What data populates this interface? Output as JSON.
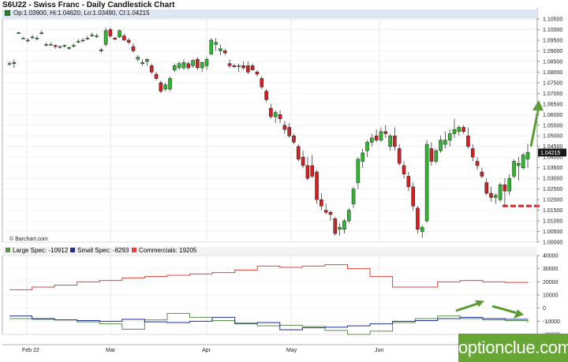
{
  "header": {
    "title": "S6U22 - Swiss Franc - Daily Candlestick Chart",
    "ohlc": "Op:1.03900, Hi:1.04620, Lo:1.03490, Cl:1.04215"
  },
  "credit": "© Barchart.com",
  "logo_text": "optionclue.com",
  "colors": {
    "up": "#2fb82f",
    "down": "#d42020",
    "large_spec": "#5a8f4a",
    "small_spec": "#1f2f8f",
    "commercials": "#e0443a",
    "support": "#e02020",
    "arrow": "#5a9e32"
  },
  "chart_data": [
    {
      "type": "candlestick",
      "title": "S6U22 - Swiss Franc - Daily Candlestick Chart",
      "y_ticks": [
        "1.10500",
        "1.10000",
        "1.09500",
        "1.09000",
        "1.08500",
        "1.08000",
        "1.07500",
        "1.07000",
        "1.06500",
        "1.06000",
        "1.05500",
        "1.05000",
        "1.04500",
        "1.04000",
        "1.03500",
        "1.03000",
        "1.02500",
        "1.02000",
        "1.01500",
        "1.01000",
        "1.00500",
        "1.00000"
      ],
      "ylim": [
        1.0,
        1.105
      ],
      "x_ticks": [
        "Feb 22",
        "Mar",
        "Apr",
        "May",
        "Jun"
      ],
      "last_price": "1.04215",
      "ohlc": [
        [
          1.084,
          1.085,
          1.083,
          1.084
        ],
        [
          1.084,
          1.086,
          1.082,
          1.0845
        ],
        [
          1.0985,
          1.099,
          1.098,
          1.0985
        ],
        [
          1.096,
          1.0965,
          1.0955,
          1.096
        ],
        [
          1.095,
          1.096,
          1.094,
          1.095
        ],
        [
          1.0965,
          1.0975,
          1.0955,
          1.0965
        ],
        [
          1.096,
          1.097,
          1.095,
          1.096
        ],
        [
          1.0985,
          1.0995,
          1.0975,
          1.0985
        ],
        [
          1.093,
          1.094,
          1.092,
          1.093
        ],
        [
          1.093,
          1.094,
          1.0925,
          1.093
        ],
        [
          1.0925,
          1.093,
          1.091,
          1.092
        ],
        [
          1.092,
          1.0925,
          1.091,
          1.092
        ],
        [
          1.0925,
          1.093,
          1.0915,
          1.0925
        ],
        [
          1.0915,
          1.092,
          1.0905,
          1.0915
        ],
        [
          1.0925,
          1.0935,
          1.0915,
          1.0925
        ],
        [
          1.0945,
          1.0955,
          1.0935,
          1.0945
        ],
        [
          1.095,
          1.096,
          1.094,
          1.095
        ],
        [
          1.096,
          1.097,
          1.095,
          1.096
        ],
        [
          1.0975,
          1.0985,
          1.0965,
          1.0975
        ],
        [
          1.097,
          1.098,
          1.096,
          1.097
        ],
        [
          1.0905,
          1.0915,
          1.089,
          1.09
        ],
        [
          1.093,
          1.101,
          1.092,
          1.0995
        ],
        [
          1.1,
          1.101,
          1.096,
          1.097
        ],
        [
          1.096,
          1.0965,
          1.095,
          1.0955
        ],
        [
          1.0965,
          1.1,
          1.096,
          1.0995
        ],
        [
          1.097,
          1.098,
          1.095,
          1.095
        ],
        [
          1.095,
          1.096,
          1.093,
          1.094
        ],
        [
          1.092,
          1.0935,
          1.089,
          1.09
        ],
        [
          1.086,
          1.088,
          1.085,
          1.087
        ],
        [
          1.084,
          1.086,
          1.083,
          1.0845
        ],
        [
          1.085,
          1.0865,
          1.083,
          1.086
        ],
        [
          1.083,
          1.084,
          1.079,
          1.08
        ],
        [
          1.079,
          1.08,
          1.076,
          1.077
        ],
        [
          1.075,
          1.076,
          1.07,
          1.071
        ],
        [
          1.072,
          1.075,
          1.071,
          1.074
        ],
        [
          1.072,
          1.078,
          1.071,
          1.077
        ],
        [
          1.081,
          1.084,
          1.08,
          1.083
        ],
        [
          1.082,
          1.085,
          1.081,
          1.084
        ],
        [
          1.082,
          1.086,
          1.081,
          1.0845
        ],
        [
          1.084,
          1.085,
          1.081,
          1.082
        ],
        [
          1.083,
          1.086,
          1.082,
          1.0855
        ],
        [
          1.086,
          1.087,
          1.081,
          1.082
        ],
        [
          1.082,
          1.085,
          1.08,
          1.0845
        ],
        [
          1.083,
          1.087,
          1.081,
          1.086
        ],
        [
          1.0885,
          1.096,
          1.088,
          1.095
        ],
        [
          1.093,
          1.096,
          1.09,
          1.094
        ],
        [
          1.09,
          1.093,
          1.088,
          1.091
        ],
        [
          1.09,
          1.091,
          1.088,
          1.089
        ],
        [
          1.084,
          1.086,
          1.082,
          1.083
        ],
        [
          1.083,
          1.084,
          1.082,
          1.0825
        ],
        [
          1.083,
          1.084,
          1.08,
          1.083
        ],
        [
          1.083,
          1.085,
          1.081,
          1.082
        ],
        [
          1.083,
          1.085,
          1.079,
          1.08
        ],
        [
          1.083,
          1.084,
          1.081,
          1.081
        ],
        [
          1.08,
          1.081,
          1.078,
          1.079
        ],
        [
          1.077,
          1.078,
          1.072,
          1.073
        ],
        [
          1.071,
          1.072,
          1.066,
          1.067
        ],
        [
          1.063,
          1.065,
          1.058,
          1.059
        ],
        [
          1.059,
          1.062,
          1.056,
          1.061
        ],
        [
          1.06,
          1.062,
          1.056,
          1.058
        ],
        [
          1.055,
          1.057,
          1.051,
          1.053
        ],
        [
          1.054,
          1.056,
          1.049,
          1.05
        ],
        [
          1.05,
          1.051,
          1.046,
          1.047
        ],
        [
          1.045,
          1.046,
          1.038,
          1.039
        ],
        [
          1.04,
          1.043,
          1.035,
          1.036
        ],
        [
          1.036,
          1.04,
          1.029,
          1.03
        ],
        [
          1.036,
          1.041,
          1.03,
          1.031
        ],
        [
          1.033,
          1.034,
          1.018,
          1.02
        ],
        [
          1.02,
          1.023,
          1.015,
          1.017
        ],
        [
          1.015,
          1.018,
          1.013,
          1.014
        ],
        [
          1.014,
          1.015,
          1.01,
          1.013
        ],
        [
          1.011,
          1.012,
          1.003,
          1.004
        ],
        [
          1.006,
          1.009,
          1.003,
          1.007
        ],
        [
          1.006,
          1.011,
          1.004,
          1.01
        ],
        [
          1.01,
          1.016,
          1.009,
          1.015
        ],
        [
          1.018,
          1.026,
          1.016,
          1.025
        ],
        [
          1.028,
          1.04,
          1.025,
          1.039
        ],
        [
          1.038,
          1.044,
          1.035,
          1.042
        ],
        [
          1.043,
          1.048,
          1.04,
          1.047
        ],
        [
          1.047,
          1.051,
          1.045,
          1.049
        ],
        [
          1.05,
          1.053,
          1.047,
          1.048
        ],
        [
          1.048,
          1.054,
          1.047,
          1.052
        ],
        [
          1.052,
          1.055,
          1.049,
          1.051
        ],
        [
          1.045,
          1.051,
          1.043,
          1.05
        ],
        [
          1.05,
          1.054,
          1.043,
          1.045
        ],
        [
          1.044,
          1.046,
          1.036,
          1.037
        ],
        [
          1.036,
          1.038,
          1.03,
          1.032
        ],
        [
          1.031,
          1.033,
          1.024,
          1.026
        ],
        [
          1.026,
          1.028,
          1.015,
          1.017
        ],
        [
          1.016,
          1.017,
          1.004,
          1.006
        ],
        [
          1.005,
          1.008,
          1.002,
          1.007
        ],
        [
          1.01,
          1.048,
          1.009,
          1.046
        ],
        [
          1.044,
          1.047,
          1.036,
          1.038
        ],
        [
          1.038,
          1.044,
          1.037,
          1.043
        ],
        [
          1.043,
          1.05,
          1.042,
          1.048
        ],
        [
          1.046,
          1.052,
          1.044,
          1.048
        ],
        [
          1.048,
          1.053,
          1.045,
          1.051
        ],
        [
          1.051,
          1.058,
          1.049,
          1.053
        ],
        [
          1.052,
          1.055,
          1.05,
          1.054
        ],
        [
          1.054,
          1.055,
          1.051,
          1.052
        ],
        [
          1.05,
          1.054,
          1.044,
          1.045
        ],
        [
          1.044,
          1.046,
          1.038,
          1.04
        ],
        [
          1.038,
          1.04,
          1.034,
          1.036
        ],
        [
          1.033,
          1.035,
          1.03,
          1.031
        ],
        [
          1.028,
          1.03,
          1.022,
          1.023
        ],
        [
          1.023,
          1.026,
          1.019,
          1.021
        ],
        [
          1.021,
          1.023,
          1.018,
          1.022
        ],
        [
          1.02,
          1.028,
          1.019,
          1.027
        ],
        [
          1.027,
          1.03,
          1.017,
          1.024
        ],
        [
          1.024,
          1.032,
          1.022,
          1.03
        ],
        [
          1.031,
          1.039,
          1.03,
          1.038
        ],
        [
          1.036,
          1.04,
          1.029,
          1.037
        ],
        [
          1.035,
          1.042,
          1.034,
          1.041
        ],
        [
          1.039,
          1.0462,
          1.0349,
          1.0422
        ]
      ],
      "annotations": [
        {
          "kind": "support_level",
          "value": 1.017,
          "x_from": 0.72,
          "x_to": 0.76
        },
        {
          "kind": "up_arrow"
        }
      ]
    },
    {
      "type": "line",
      "title": "COT",
      "y_ticks": [
        "40000",
        "30000",
        "20000",
        "10000",
        "0",
        "-10000",
        "-20000"
      ],
      "ylim": [
        -20000,
        40000
      ],
      "series": [
        {
          "name": "Large Spec: -10912",
          "step": true,
          "values": [
            -8000,
            -8500,
            -9000,
            -10500,
            -12000,
            -16000,
            -9000,
            -4000,
            -7000,
            -9500,
            -12000,
            -13500,
            -13000,
            -14000,
            -17000,
            -20000,
            -17500,
            -11000,
            -8000,
            -6000,
            -8000,
            -9000,
            -9500,
            -10912
          ]
        },
        {
          "name": "Small Spec: -8293",
          "step": true,
          "values": [
            -6000,
            -8000,
            -9000,
            -9500,
            -10000,
            -8500,
            -10500,
            -11000,
            -10000,
            -7000,
            -11500,
            -11000,
            -16500,
            -15000,
            -14500,
            -13500,
            -12000,
            -10000,
            -9500,
            -8000,
            -7000,
            -8000,
            -8500,
            -8293
          ]
        },
        {
          "name": "Commercials: 19205",
          "step": true,
          "values": [
            14000,
            16000,
            17500,
            20000,
            21000,
            23000,
            24000,
            25000,
            26000,
            27000,
            29000,
            32000,
            31000,
            32000,
            33000,
            30000,
            24000,
            16000,
            16000,
            20000,
            21000,
            20000,
            19500,
            19205
          ]
        }
      ],
      "annotations": [
        {
          "kind": "arrow_up_right"
        },
        {
          "kind": "arrow_down_right"
        }
      ]
    }
  ]
}
